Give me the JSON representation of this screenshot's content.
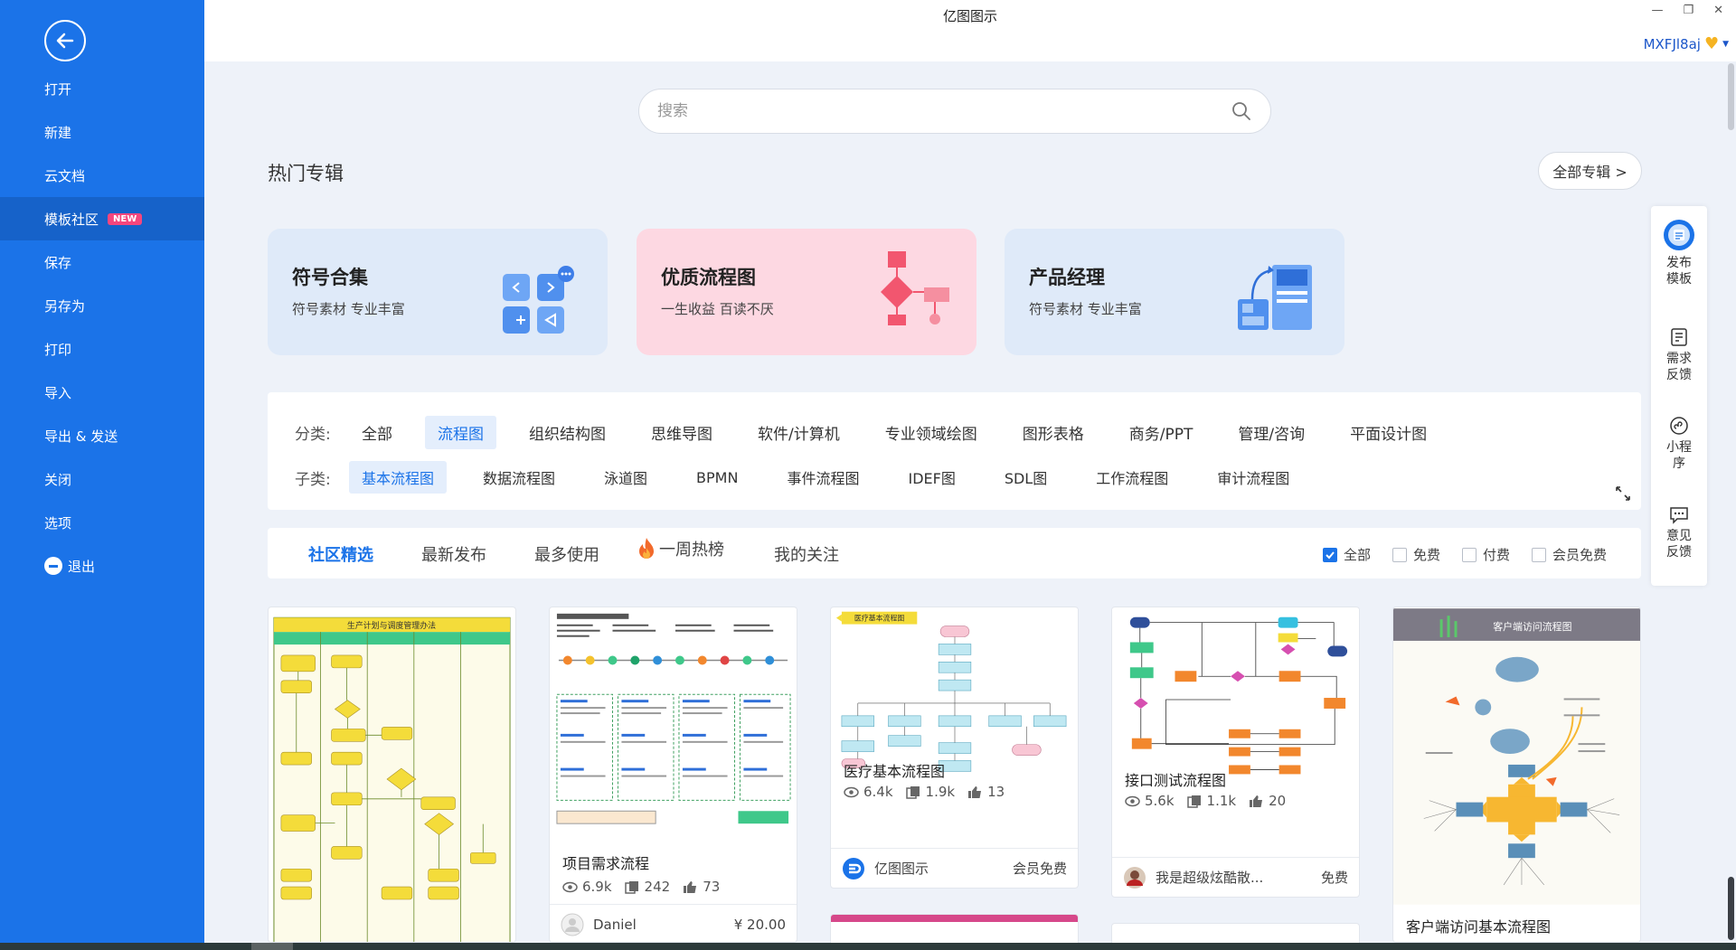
{
  "app": {
    "title": "亿图图示",
    "user": "MXFJl8aj",
    "window_controls": [
      "—",
      "❐",
      "✕"
    ]
  },
  "sidebar": {
    "items": [
      {
        "label": "打开"
      },
      {
        "label": "新建"
      },
      {
        "label": "云文档"
      },
      {
        "label": "模板社区",
        "badge": "NEW",
        "active": true
      },
      {
        "label": "保存"
      },
      {
        "label": "另存为"
      },
      {
        "label": "打印"
      },
      {
        "label": "导入"
      },
      {
        "label": "导出 & 发送"
      },
      {
        "label": "关闭"
      },
      {
        "label": "选项"
      },
      {
        "label": "退出"
      }
    ]
  },
  "search": {
    "placeholder": "搜索"
  },
  "hot": {
    "title": "热门专辑",
    "all_label": "全部专辑 >",
    "cards": [
      {
        "title": "符号合集",
        "subtitle": "符号素材 专业丰富"
      },
      {
        "title": "优质流程图",
        "subtitle": "一生收益 百读不厌"
      },
      {
        "title": "产品经理",
        "subtitle": "符号素材 专业丰富"
      }
    ]
  },
  "categories": {
    "label": "分类:",
    "items": [
      "全部",
      "流程图",
      "组织结构图",
      "思维导图",
      "软件/计算机",
      "专业领域绘图",
      "图形表格",
      "商务/PPT",
      "管理/咨询",
      "平面设计图"
    ],
    "selected": "流程图",
    "sub_label": "子类:",
    "sub_items": [
      "基本流程图",
      "数据流程图",
      "泳道图",
      "BPMN",
      "事件流程图",
      "IDEF图",
      "SDL图",
      "工作流程图",
      "审计流程图"
    ],
    "sub_selected": "基本流程图"
  },
  "tabs": {
    "items": [
      "社区精选",
      "最新发布",
      "最多使用",
      "一周热榜",
      "我的关注"
    ],
    "selected": "社区精选",
    "filters": [
      {
        "label": "全部",
        "checked": true
      },
      {
        "label": "免费",
        "checked": false
      },
      {
        "label": "付费",
        "checked": false
      },
      {
        "label": "会员免费",
        "checked": false
      }
    ]
  },
  "templates": [
    {
      "name": "",
      "thumb_title": "生产计划与调度管理办法"
    },
    {
      "name": "项目需求流程",
      "views": "6.9k",
      "copies": "242",
      "likes": "73",
      "author": "Daniel",
      "price": "¥ 20.00"
    },
    {
      "name": "医疗基本流程图",
      "thumb_title": "医疗基本流程图",
      "views": "6.4k",
      "copies": "1.9k",
      "likes": "13",
      "author": "亿图图示",
      "price": "会员免费"
    },
    {
      "name": "接口测试流程图",
      "views": "5.6k",
      "copies": "1.1k",
      "likes": "20",
      "author": "我是超级炫酷散...",
      "price": "免费"
    },
    {
      "name": "客户端访问基本流程图",
      "thumb_title": "客户端访问流程图"
    }
  ],
  "float_panel": [
    {
      "label": "发布\n模板"
    },
    {
      "label": "需求\n反馈"
    },
    {
      "label": "小程\n序"
    },
    {
      "label": "意见\n反馈"
    }
  ],
  "colors": {
    "sidebar": "#1b73e8",
    "accent": "#1b73e8",
    "badge": "#f5467d",
    "background": "#eef2f9"
  }
}
